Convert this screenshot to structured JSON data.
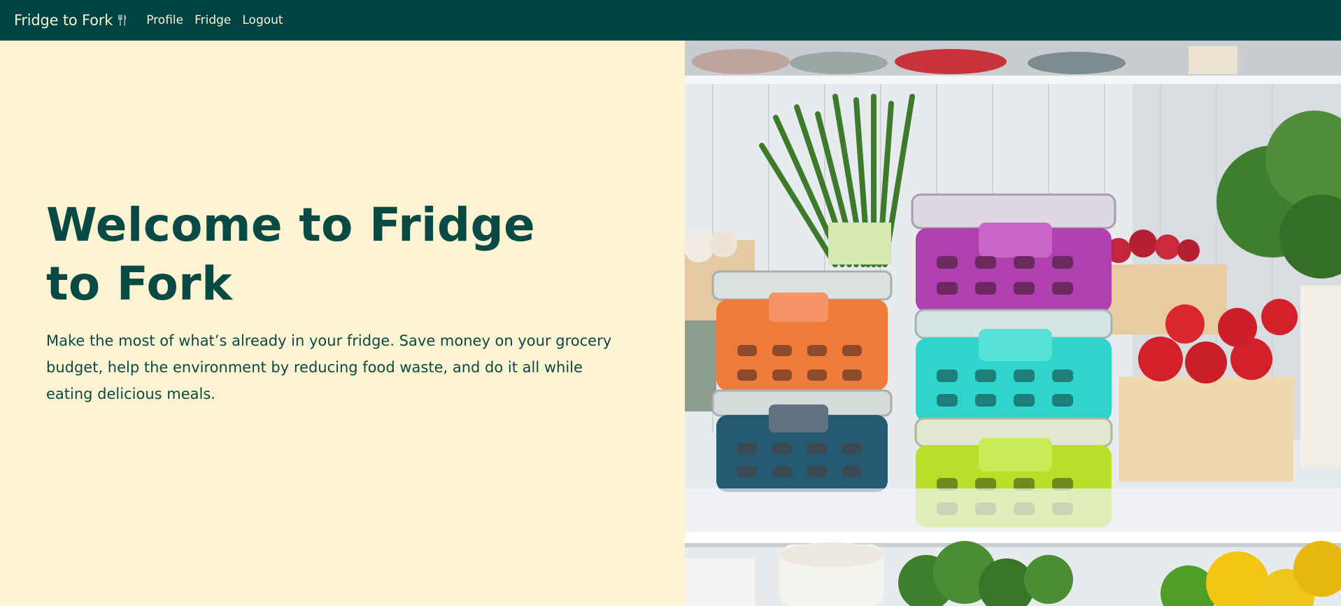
{
  "navbar": {
    "brand": "Fridge to Fork",
    "brand_icon": "fork-knife-icon",
    "links": [
      {
        "label": "Profile"
      },
      {
        "label": "Fridge"
      },
      {
        "label": "Logout"
      }
    ]
  },
  "hero": {
    "title": "Welcome to Fridge to Fork",
    "description": "Make the most of what’s already in your fridge. Save money on your grocery budget, help the environment by reducing food waste, and do it all while eating delicious meals."
  },
  "colors": {
    "nav_bg": "#004343",
    "hero_bg": "#FBF3D1",
    "text": "#0A4A44",
    "nav_text": "#FBF3D1"
  }
}
